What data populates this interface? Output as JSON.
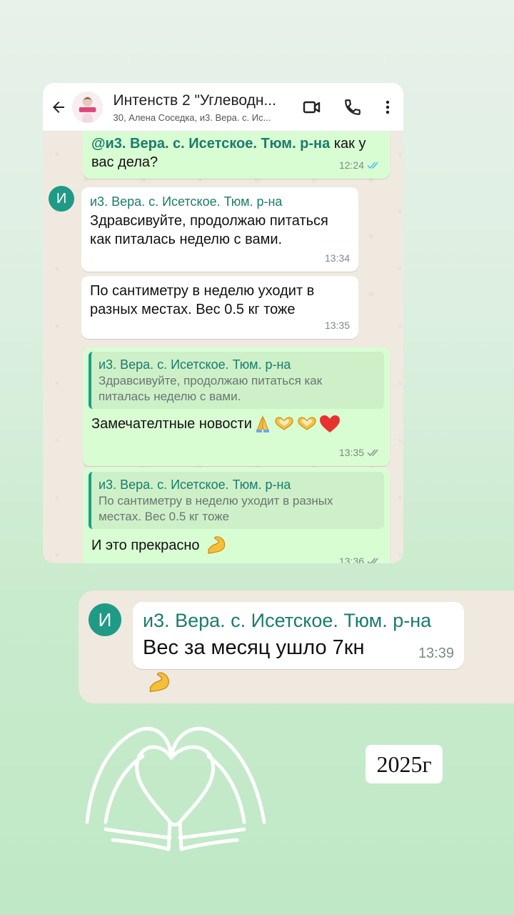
{
  "header": {
    "title": "Интенств 2 \"Углеводн...",
    "subtitle": "30, Алена Соседка, и3. Вера. с. Ис..."
  },
  "messages": {
    "m1": {
      "mention": "@и3. Вера. с. Исетское. Тюм. р-на",
      "text": "как у вас дела?",
      "time": "12:24"
    },
    "m2": {
      "avatar_letter": "И",
      "sender": "и3. Вера. с. Исетское. Тюм. р-на",
      "text": "Здравсивуйте, продолжаю питаться как питалась неделю с вами.",
      "time": "13:34"
    },
    "m3": {
      "text": "По сантиметру в неделю уходит в разных местах. Вес 0.5 кг тоже",
      "time": "13:35"
    },
    "m4": {
      "quote_sender": "и3. Вера. с. Исетское. Тюм. р-на",
      "quote_text": "Здравсивуйте, продолжаю питаться как питалась неделю с вами.",
      "text": "Замечателтные новости",
      "time": "13:35"
    },
    "m5": {
      "quote_sender": "и3. Вера. с. Исетское. Тюм. р-на",
      "quote_text": "По сантиметру в неделю уходит в разных местах. Вес 0.5 кг тоже",
      "text": "И это прекрасно",
      "time": "13:36"
    }
  },
  "snippet": {
    "avatar_letter": "И",
    "sender": "и3. Вера. с. Исетское. Тюм. р-на",
    "text": "Вес за месяц ушло 7кн",
    "time": "13:39"
  },
  "year_label": "2025г",
  "colors": {
    "outgoing_bubble": "#d9fdd3",
    "incoming_bubble": "#ffffff",
    "accent": "#1b7b6e",
    "read_check": "#53bdeb"
  },
  "icons": [
    "back-arrow-icon",
    "video-call-icon",
    "phone-icon",
    "more-options-icon",
    "double-check-icon",
    "pray-emoji",
    "heart-hands-emoji",
    "red-heart-emoji",
    "flexed-biceps-emoji"
  ]
}
